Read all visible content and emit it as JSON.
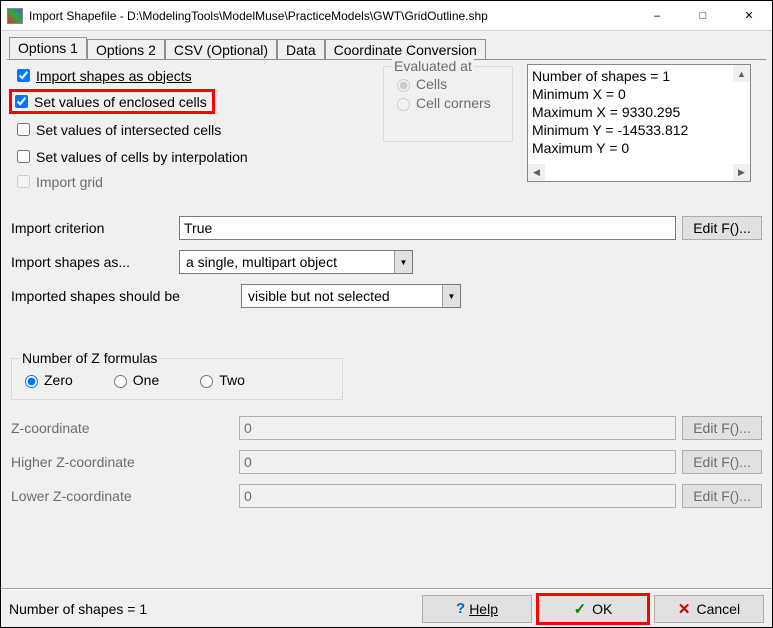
{
  "window": {
    "title": "Import Shapefile - D:\\ModelingTools\\ModelMuse\\PracticeModels\\GWT\\GridOutline.shp"
  },
  "tabs": [
    "Options 1",
    "Options 2",
    "CSV (Optional)",
    "Data",
    "Coordinate Conversion"
  ],
  "checkboxes": {
    "import_shapes": "Import shapes as objects",
    "enclosed": "Set values of enclosed cells",
    "intersected": "Set values of intersected cells",
    "interpolation": "Set values of cells by interpolation",
    "import_grid": "Import grid"
  },
  "evaluated": {
    "legend": "Evaluated at",
    "cells": "Cells",
    "corners": "Cell corners"
  },
  "stats": {
    "lines": [
      "Number of shapes = 1",
      "Minimum X = 0",
      "Maximum X = 9330.295",
      "Minimum Y = -14533.812",
      "Maximum Y = 0"
    ]
  },
  "criterion": {
    "label": "Import criterion",
    "value": "True",
    "edit_btn": "Edit F()..."
  },
  "shapes_as": {
    "label": "Import shapes as...",
    "value": "a single, multipart object"
  },
  "visibility": {
    "label": "Imported shapes should be",
    "value": "visible but not selected"
  },
  "zformulas": {
    "legend": "Number of Z formulas",
    "zero": "Zero",
    "one": "One",
    "two": "Two"
  },
  "zcoords": {
    "z": {
      "label": "Z-coordinate",
      "value": "0",
      "btn": "Edit F()..."
    },
    "hz": {
      "label": "Higher Z-coordinate",
      "value": "0",
      "btn": "Edit F()..."
    },
    "lz": {
      "label": "Lower Z-coordinate",
      "value": "0",
      "btn": "Edit F()..."
    }
  },
  "footer": {
    "status": "Number of shapes = 1",
    "help": "Help",
    "ok": "OK",
    "cancel": "Cancel"
  }
}
